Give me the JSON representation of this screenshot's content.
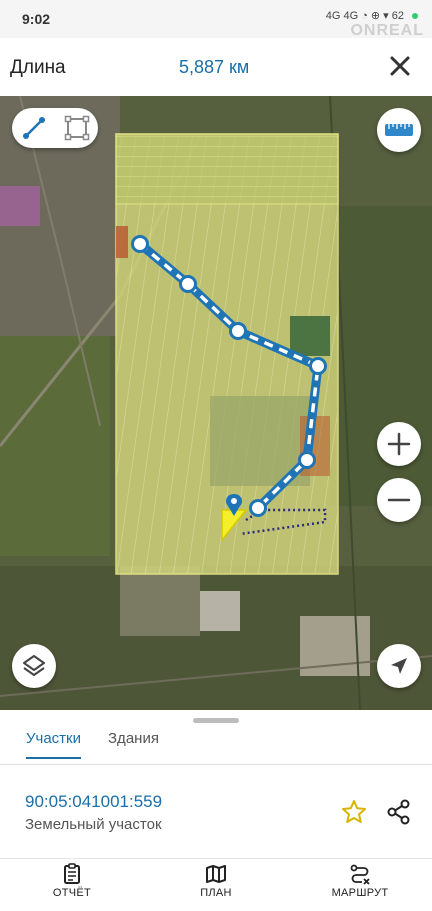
{
  "status_bar": {
    "time": "9:02",
    "indicators": "4G 4G ◔ ⊕ ▾ 62"
  },
  "watermark": "ONREAL",
  "header": {
    "title": "Длина",
    "length_value": "5,887 км"
  },
  "map": {
    "route_color": "#1f74b5",
    "parcel_fill": "#e9e57a",
    "icons": {
      "line_tool": "line-measure-icon",
      "area_tool": "area-measure-icon",
      "ruler": "ruler-icon",
      "zoom_in": "plus-icon",
      "zoom_out": "minus-icon",
      "layers": "layers-icon",
      "locate": "navigation-arrow-icon"
    }
  },
  "tabs": [
    {
      "label": "Участки",
      "active": true
    },
    {
      "label": "Здания",
      "active": false
    }
  ],
  "parcel": {
    "cadastral_number": "90:05:041001:559",
    "type": "Земельный участок"
  },
  "bottom_nav": [
    {
      "label": "ОТЧЁТ",
      "icon": "clipboard-icon"
    },
    {
      "label": "ПЛАН",
      "icon": "map-icon"
    },
    {
      "label": "МАРШРУТ",
      "icon": "route-icon"
    }
  ]
}
